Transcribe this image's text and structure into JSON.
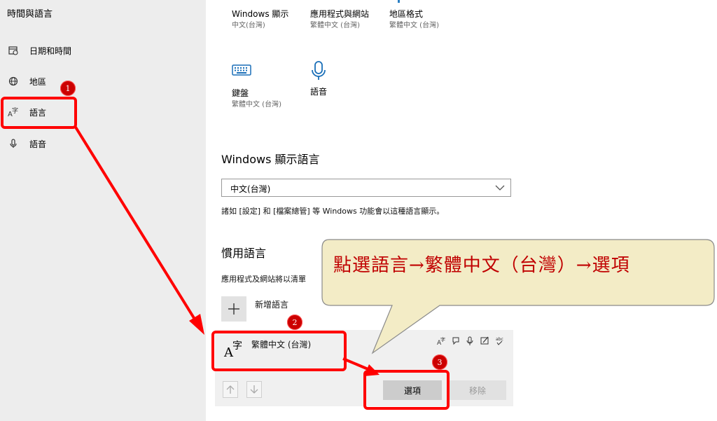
{
  "sidebar": {
    "title": "時間與語言",
    "items": [
      {
        "label": "日期和時間",
        "icon": "calendar-clock-icon"
      },
      {
        "label": "地區",
        "icon": "globe-icon"
      },
      {
        "label": "語言",
        "icon": "language-icon"
      },
      {
        "label": "語音",
        "icon": "microphone-icon"
      }
    ]
  },
  "related": {
    "tiles": [
      {
        "name": "Windows 顯示",
        "value": "中文(台灣)",
        "icon": ""
      },
      {
        "name": "應用程式與網站",
        "value": "繁體中文 (台灣)",
        "icon": ""
      },
      {
        "name": "地區格式",
        "value": "繁體中文 (台灣)",
        "icon": ""
      },
      {
        "name": "鍵盤",
        "value": "繁體中文 (台灣)",
        "icon": "keyboard-icon"
      },
      {
        "name": "語音",
        "value": "",
        "icon": "microphone-icon"
      }
    ]
  },
  "display_language": {
    "heading": "Windows 顯示語言",
    "selected": "中文(台灣)",
    "note": "諸如 [設定] 和 [檔案總管] 等 Windows 功能會以這種語言顯示。"
  },
  "preferred": {
    "heading": "慣用語言",
    "desc": "應用程式及網站將以清單",
    "add_label": "新增語言",
    "language": {
      "name": "繁體中文 (台灣)",
      "glyph_a": "A",
      "glyph_zi": "字",
      "feature_icons": [
        "display-language-icon",
        "speech-recognition-icon",
        "microphone-icon",
        "handwriting-icon",
        "spellcheck-icon"
      ],
      "spell_text": "abc"
    },
    "options_label": "選項",
    "remove_label": "移除"
  },
  "annotation": {
    "callout_text": "點選語言→繁體中文（台灣）→選項",
    "badges": [
      "1",
      "2",
      "3"
    ],
    "accent_color": "#ff0000",
    "callout_fill": "#f3ecc6"
  }
}
